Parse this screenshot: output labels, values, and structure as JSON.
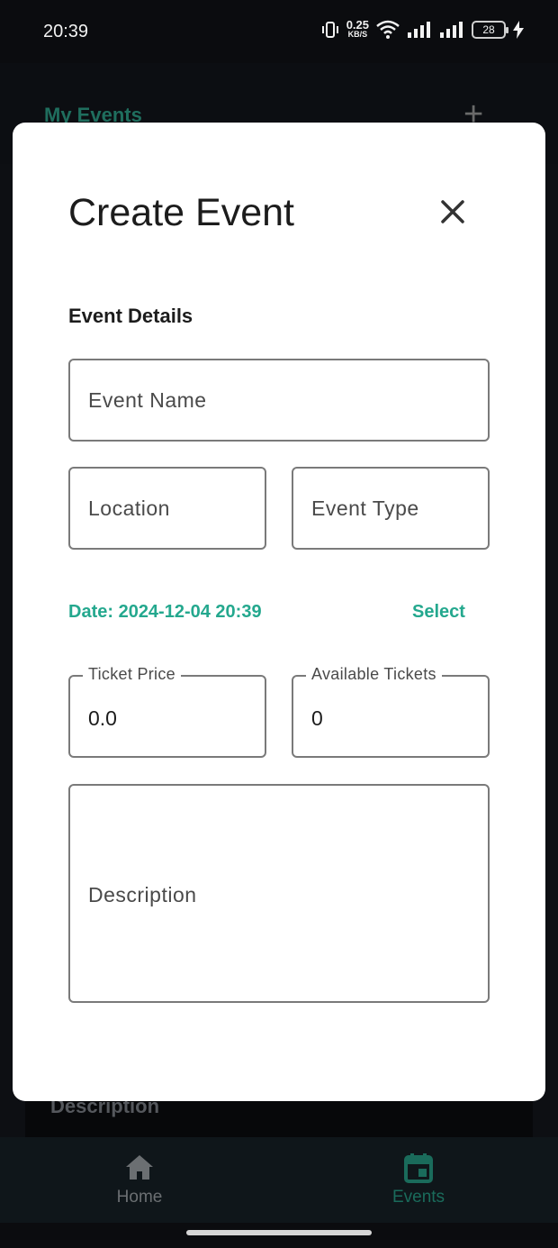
{
  "status_bar": {
    "time": "20:39",
    "net_speed_value": "0.25",
    "net_speed_unit": "KB/S",
    "battery": "28"
  },
  "background": {
    "title": "My Events",
    "card_label": "Description"
  },
  "dialog": {
    "title": "Create Event",
    "section_title": "Event Details",
    "fields": {
      "event_name": {
        "placeholder": "Event Name"
      },
      "location": {
        "placeholder": "Location"
      },
      "event_type": {
        "placeholder": "Event Type"
      },
      "ticket_price": {
        "label": "Ticket Price",
        "value": "0.0"
      },
      "available_tickets": {
        "label": "Available Tickets",
        "value": "0"
      },
      "description": {
        "placeholder": "Description"
      }
    },
    "date_text": "Date: 2024-12-04 20:39",
    "select_label": "Select"
  },
  "bottom_nav": {
    "items": [
      {
        "label": "Home",
        "icon": "home-icon",
        "active": false
      },
      {
        "label": "Events",
        "icon": "calendar-icon",
        "active": true
      }
    ]
  },
  "colors": {
    "accent": "#24a88e",
    "nav_active": "#1a6b5b",
    "background": "#0d0f13"
  }
}
